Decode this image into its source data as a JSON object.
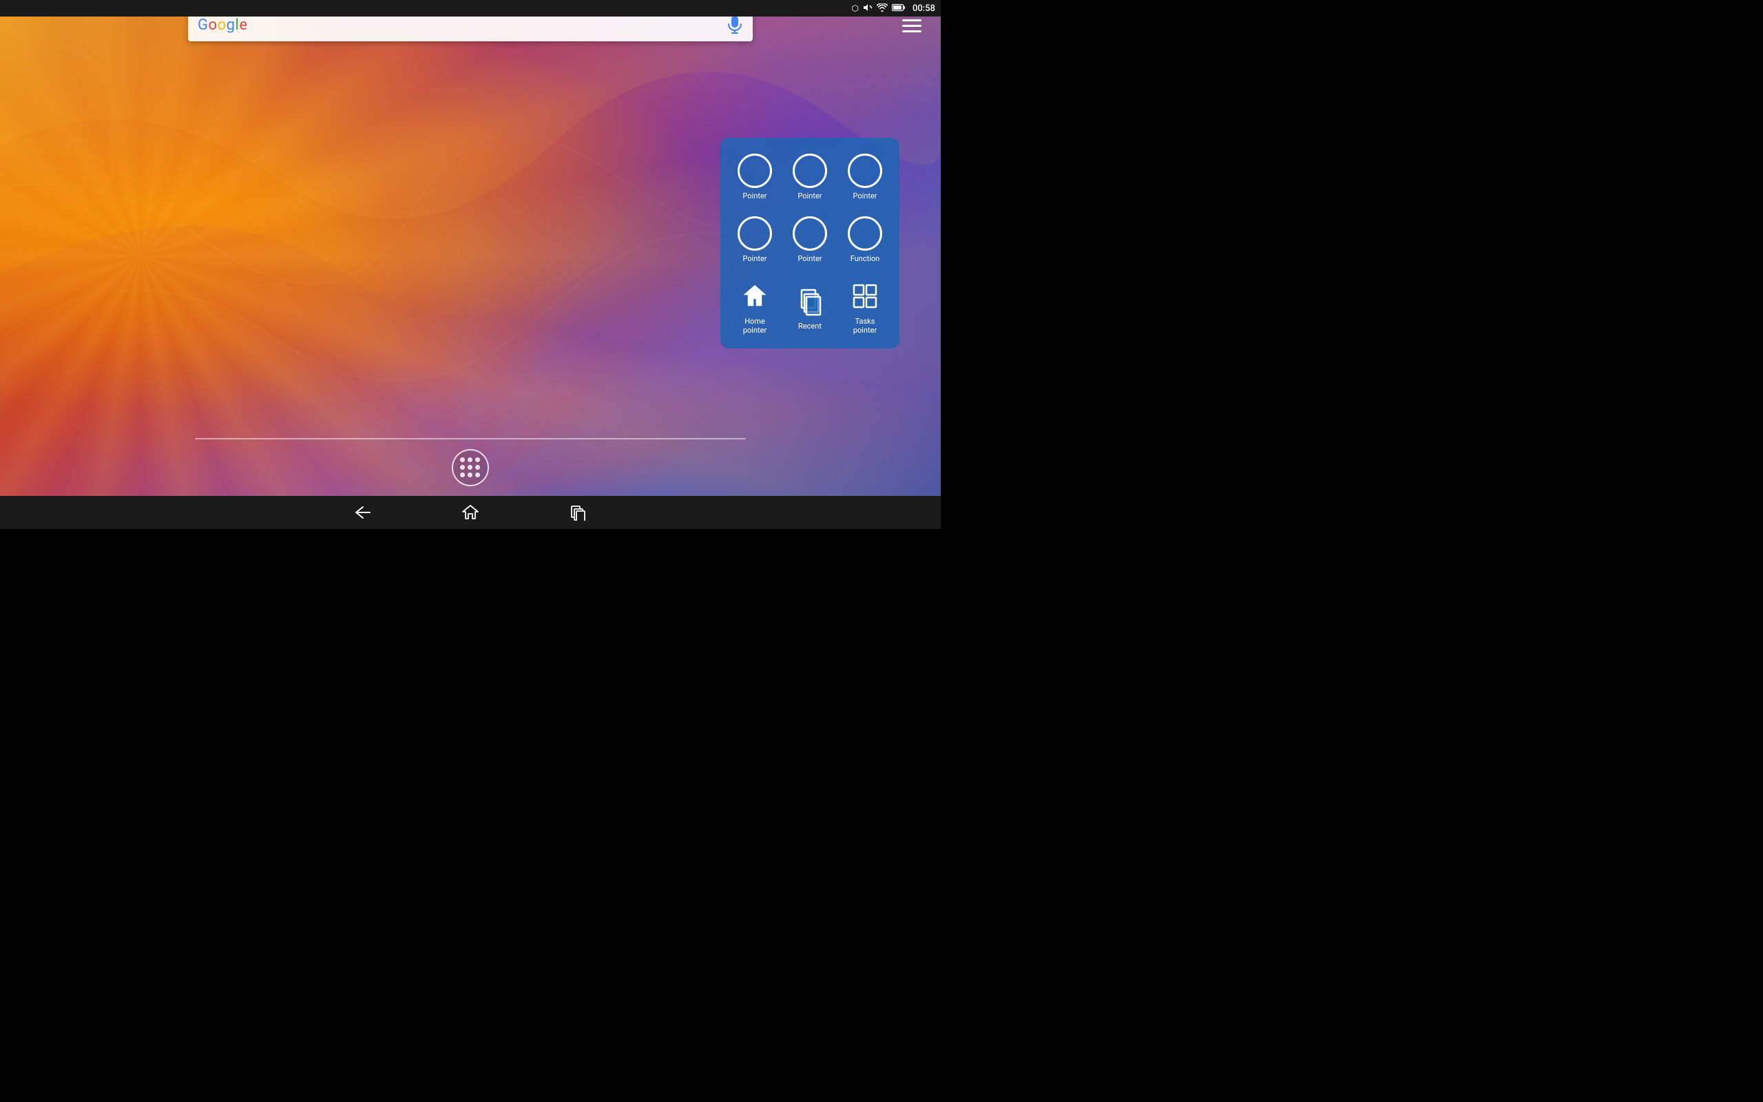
{
  "statusBar": {
    "time": "00:58",
    "icons": [
      "bluetooth",
      "mute",
      "wifi",
      "battery"
    ]
  },
  "searchBar": {
    "placeholder": "Google",
    "text": "Google"
  },
  "menuButton": {
    "label": "Menu"
  },
  "widgetPanel": {
    "buttons": [
      {
        "id": "pointer-1",
        "label": "Pointer",
        "type": "circle"
      },
      {
        "id": "pointer-2",
        "label": "Pointer",
        "type": "circle"
      },
      {
        "id": "pointer-3",
        "label": "Pointer",
        "type": "circle"
      },
      {
        "id": "pointer-4",
        "label": "Pointer",
        "type": "circle"
      },
      {
        "id": "pointer-5",
        "label": "Pointer",
        "type": "circle"
      },
      {
        "id": "function-1",
        "label": "Function",
        "type": "circle"
      },
      {
        "id": "home-pointer",
        "label": "Home pointer",
        "type": "home"
      },
      {
        "id": "recent",
        "label": "Recent",
        "type": "recent"
      },
      {
        "id": "tasks-pointer",
        "label": "Tasks pointer",
        "type": "tasks"
      }
    ]
  },
  "appDrawer": {
    "label": "App drawer"
  },
  "navBar": {
    "back": "Back",
    "home": "Home",
    "recents": "Recents"
  }
}
